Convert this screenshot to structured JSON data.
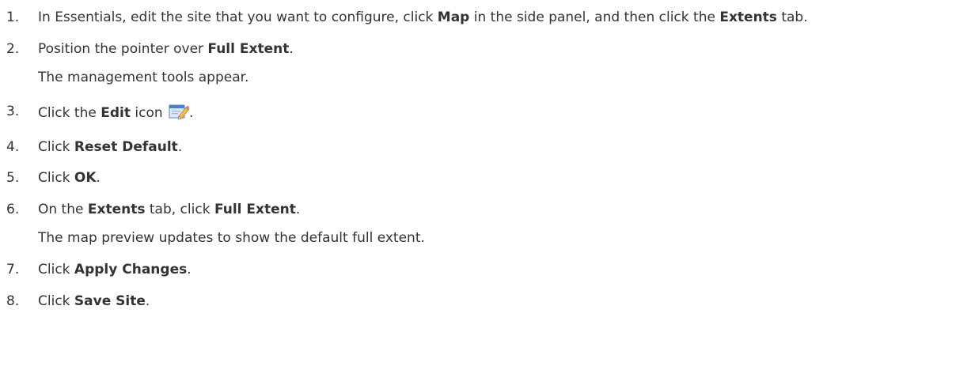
{
  "steps": [
    {
      "number": "1.",
      "parts": {
        "a": "In Essentials, edit the site that you want to configure, click ",
        "b": "Map",
        "c": " in the side panel, and then click the ",
        "d": "Extents",
        "e": " tab."
      }
    },
    {
      "number": "2.",
      "parts": {
        "a": "Position the pointer over ",
        "b": "Full Extent",
        "c": "."
      },
      "result": "The management tools appear."
    },
    {
      "number": "3.",
      "parts": {
        "a": "Click the ",
        "b": "Edit",
        "c": " icon ",
        "d": "."
      },
      "icon": "edit-icon"
    },
    {
      "number": "4.",
      "parts": {
        "a": "Click ",
        "b": "Reset Default",
        "c": "."
      }
    },
    {
      "number": "5.",
      "parts": {
        "a": "Click ",
        "b": "OK",
        "c": "."
      }
    },
    {
      "number": "6.",
      "parts": {
        "a": "On the ",
        "b": "Extents",
        "c": " tab, click ",
        "d": "Full Extent",
        "e": "."
      },
      "result": "The map preview updates to show the default full extent."
    },
    {
      "number": "7.",
      "parts": {
        "a": "Click ",
        "b": "Apply Changes",
        "c": "."
      }
    },
    {
      "number": "8.",
      "parts": {
        "a": "Click ",
        "b": "Save Site",
        "c": "."
      }
    }
  ]
}
